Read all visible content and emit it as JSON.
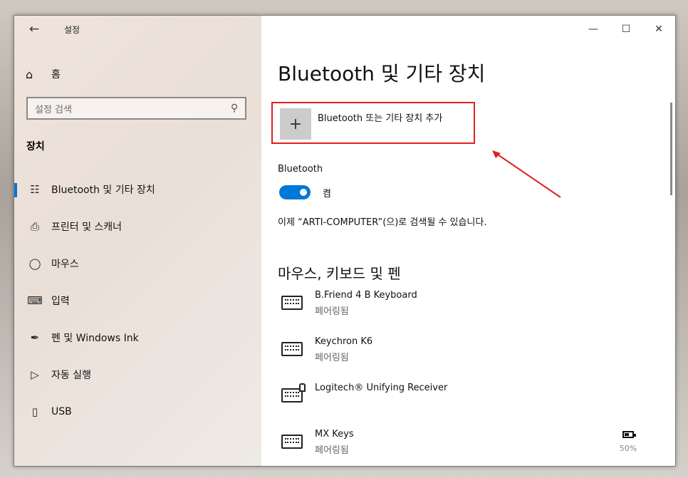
{
  "window": {
    "title": "설정"
  },
  "sidebar": {
    "home_label": "홈",
    "search_placeholder": "설정 검색",
    "section_title": "장치",
    "items": [
      {
        "label": "Bluetooth 및 기타 장치",
        "icon": "bluetooth-devices-icon",
        "active": true
      },
      {
        "label": "프린터 및 스캐너",
        "icon": "printer-icon",
        "active": false
      },
      {
        "label": "마우스",
        "icon": "mouse-icon",
        "active": false
      },
      {
        "label": "입력",
        "icon": "keyboard-icon",
        "active": false
      },
      {
        "label": "펜 및 Windows Ink",
        "icon": "pen-icon",
        "active": false
      },
      {
        "label": "자동 실행",
        "icon": "autoplay-icon",
        "active": false
      },
      {
        "label": "USB",
        "icon": "usb-icon",
        "active": false
      }
    ]
  },
  "main": {
    "title": "Bluetooth 및 기타 장치",
    "add_device_label": "Bluetooth 또는 기타 장치 추가",
    "bluetooth": {
      "heading": "Bluetooth",
      "toggle_state": "켬",
      "on": true,
      "discoverable_text": "이제 “ARTI-COMPUTER”(으)로 검색될 수 있습니다."
    },
    "input_section": {
      "heading": "마우스, 키보드 및 펜",
      "devices": [
        {
          "name": "B.Friend 4 B Keyboard",
          "status": "페어링됨",
          "icon": "keyboard-icon"
        },
        {
          "name": "Keychron K6",
          "status": "페어링됨",
          "icon": "keyboard-icon"
        },
        {
          "name": "Logitech® Unifying Receiver",
          "status": "",
          "icon": "keyboard-receiver-icon"
        },
        {
          "name": "MX Keys",
          "status": "페어링됨",
          "icon": "keyboard-icon",
          "battery": "50%"
        }
      ]
    }
  },
  "colors": {
    "accent": "#0078d7",
    "highlight": "#e02020"
  }
}
